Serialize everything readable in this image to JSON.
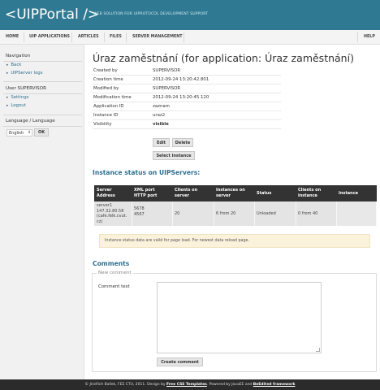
{
  "header": {
    "logo": "<UIPPortal />",
    "tagline": "WEB SOLUTION FOR UIPROTOCOL DEVELOPMENT SUPPORT"
  },
  "topnav": {
    "items": [
      "HOME",
      "UIP APPLICATIONS",
      "ARTICLES",
      "FILES",
      "SERVER MANAGEMENT"
    ],
    "help": "HELP"
  },
  "sidebar": {
    "navigation_title": "Navigation",
    "nav_links": [
      "Back",
      "UIPServer logs"
    ],
    "user_title": "User SUPERVISOR",
    "user_links": [
      "Settings",
      "Logout"
    ],
    "language_title": "Language / Language",
    "language_value": "English",
    "ok_label": "OK"
  },
  "main": {
    "title": "Úraz zaměstnání (for application: Úraz zaměstnání)",
    "details": [
      {
        "label": "Created by",
        "value": "SUPERVISOR"
      },
      {
        "label": "Creation time",
        "value": "2012-09-24 13:20:42.801"
      },
      {
        "label": "Modified by",
        "value": "SUPERVISOR"
      },
      {
        "label": "Modification time",
        "value": "2012-09-24 13:20:45.120"
      },
      {
        "label": "Application ID",
        "value": "zaznam"
      },
      {
        "label": "Instance ID",
        "value": "uraz2"
      },
      {
        "label": "Visibility",
        "value": "visible"
      }
    ],
    "edit_label": "Edit",
    "delete_label": "Delete",
    "select_instance_label": "Select instance",
    "status_title": "Instance status on UIPServers:",
    "status_table": {
      "headers": [
        [
          "Server",
          "Address"
        ],
        [
          "XML port",
          "HTTP port"
        ],
        [
          "Clients on",
          "server"
        ],
        [
          "Instances on",
          "server"
        ],
        [
          "Status"
        ],
        [
          "Clients on",
          "instance"
        ],
        [
          "Instance"
        ]
      ],
      "row": {
        "server": [
          "server1",
          "147.32.80.58",
          "(cafe.felk.cvut.",
          "cz)"
        ],
        "ports": [
          "5678",
          "4567"
        ],
        "clients_on_server": "20",
        "instances_on_server": "6 from 20",
        "status": "Unloaded",
        "clients_on_instance": "0 from 40",
        "instance": ""
      }
    },
    "notice": "Instance status data are valid for page load. For newest data reload page.",
    "comments_title": "Comments",
    "new_comment_legend": "New comment",
    "comment_text_label": "Comment text",
    "comment_value": "",
    "create_comment_label": "Create comment"
  },
  "footer": {
    "prefix": "© Jindřich Bašek, FEE CTU, 2011. Design by ",
    "link1": "Free CSS Templates",
    "middle": ". Powered by JavaEE and ",
    "link2": "BeEdited framework"
  }
}
